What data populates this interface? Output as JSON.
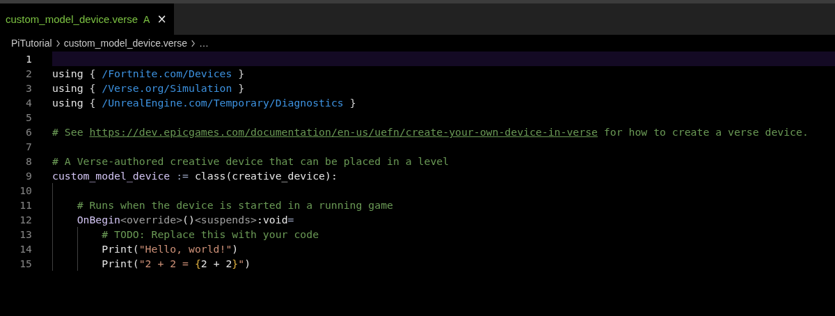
{
  "tab": {
    "label": "custom_model_device.verse",
    "badge": "A",
    "close": "×",
    "selected": true
  },
  "breadcrumb": [
    "PiTutorial",
    "custom_model_device.verse",
    "…"
  ],
  "lines": [
    {
      "number": "1",
      "current": true
    },
    {
      "number": "2",
      "current": false,
      "tokens": [
        {
          "kind": "keyword",
          "text": "using"
        },
        {
          "kind": "punct",
          "text": " { "
        },
        {
          "kind": "path",
          "text": "/Fortnite.com/Devices"
        },
        {
          "kind": "punct",
          "text": " }"
        }
      ]
    },
    {
      "number": "3",
      "current": false,
      "tokens": [
        {
          "kind": "keyword",
          "text": "using"
        },
        {
          "kind": "punct",
          "text": " { "
        },
        {
          "kind": "path",
          "text": "/Verse.org/Simulation"
        },
        {
          "kind": "punct",
          "text": " }"
        }
      ]
    },
    {
      "number": "4",
      "current": false,
      "tokens": [
        {
          "kind": "keyword",
          "text": "using"
        },
        {
          "kind": "punct",
          "text": " { "
        },
        {
          "kind": "path",
          "text": "/UnrealEngine.com/Temporary/Diagnostics"
        },
        {
          "kind": "punct",
          "text": " }"
        }
      ]
    },
    {
      "number": "5",
      "current": false
    },
    {
      "number": "6",
      "current": false,
      "tokens": [
        {
          "kind": "comment",
          "text": "# See "
        },
        {
          "kind": "link",
          "text": "https://dev.epicgames.com/documentation/en-us/uefn/create-your-own-device-in-verse"
        },
        {
          "kind": "comment",
          "text": " for how to create a verse device."
        }
      ]
    },
    {
      "number": "7",
      "current": false
    },
    {
      "number": "8",
      "current": false,
      "tokens": [
        {
          "kind": "comment",
          "text": "# A Verse-authored creative device that can be placed in a level"
        }
      ]
    },
    {
      "number": "9",
      "current": false,
      "tokens": [
        {
          "kind": "ident",
          "text": "custom_model_device"
        },
        {
          "kind": "operator",
          "text": " := "
        },
        {
          "kind": "keyword",
          "text": "class(creative_device):"
        }
      ]
    },
    {
      "number": "10",
      "current": false,
      "tokens": [
        {
          "kind": "indent"
        }
      ]
    },
    {
      "number": "11",
      "current": false,
      "tokens": [
        {
          "kind": "indent"
        },
        {
          "kind": "comment",
          "text": "# Runs when the device is started in a running game"
        }
      ]
    },
    {
      "number": "12",
      "current": false,
      "tokens": [
        {
          "kind": "indent"
        },
        {
          "kind": "ident",
          "text": "OnBegin"
        },
        {
          "kind": "specifier",
          "text": "<override>"
        },
        {
          "kind": "keyword",
          "text": "()"
        },
        {
          "kind": "specifier",
          "text": "<suspends>"
        },
        {
          "kind": "keyword",
          "text": ":void"
        },
        {
          "kind": "operator",
          "text": "="
        }
      ]
    },
    {
      "number": "13",
      "current": false,
      "tokens": [
        {
          "kind": "indent"
        },
        {
          "kind": "indent"
        },
        {
          "kind": "comment",
          "text": "# TODO: Replace this with your code"
        }
      ]
    },
    {
      "number": "14",
      "current": false,
      "tokens": [
        {
          "kind": "indent"
        },
        {
          "kind": "indent"
        },
        {
          "kind": "keyword",
          "text": "Print("
        },
        {
          "kind": "string",
          "text": "\"Hello, world!\""
        },
        {
          "kind": "keyword",
          "text": ")"
        }
      ]
    },
    {
      "number": "15",
      "current": false,
      "tokens": [
        {
          "kind": "indent"
        },
        {
          "kind": "indent"
        },
        {
          "kind": "keyword",
          "text": "Print("
        },
        {
          "kind": "string",
          "text": "\"2 + 2 = "
        },
        {
          "kind": "brace",
          "text": "{"
        },
        {
          "kind": "keyword",
          "text": "2 + 2"
        },
        {
          "kind": "brace",
          "text": "}"
        },
        {
          "kind": "string",
          "text": "\""
        },
        {
          "kind": "keyword",
          "text": ")"
        }
      ]
    }
  ]
}
